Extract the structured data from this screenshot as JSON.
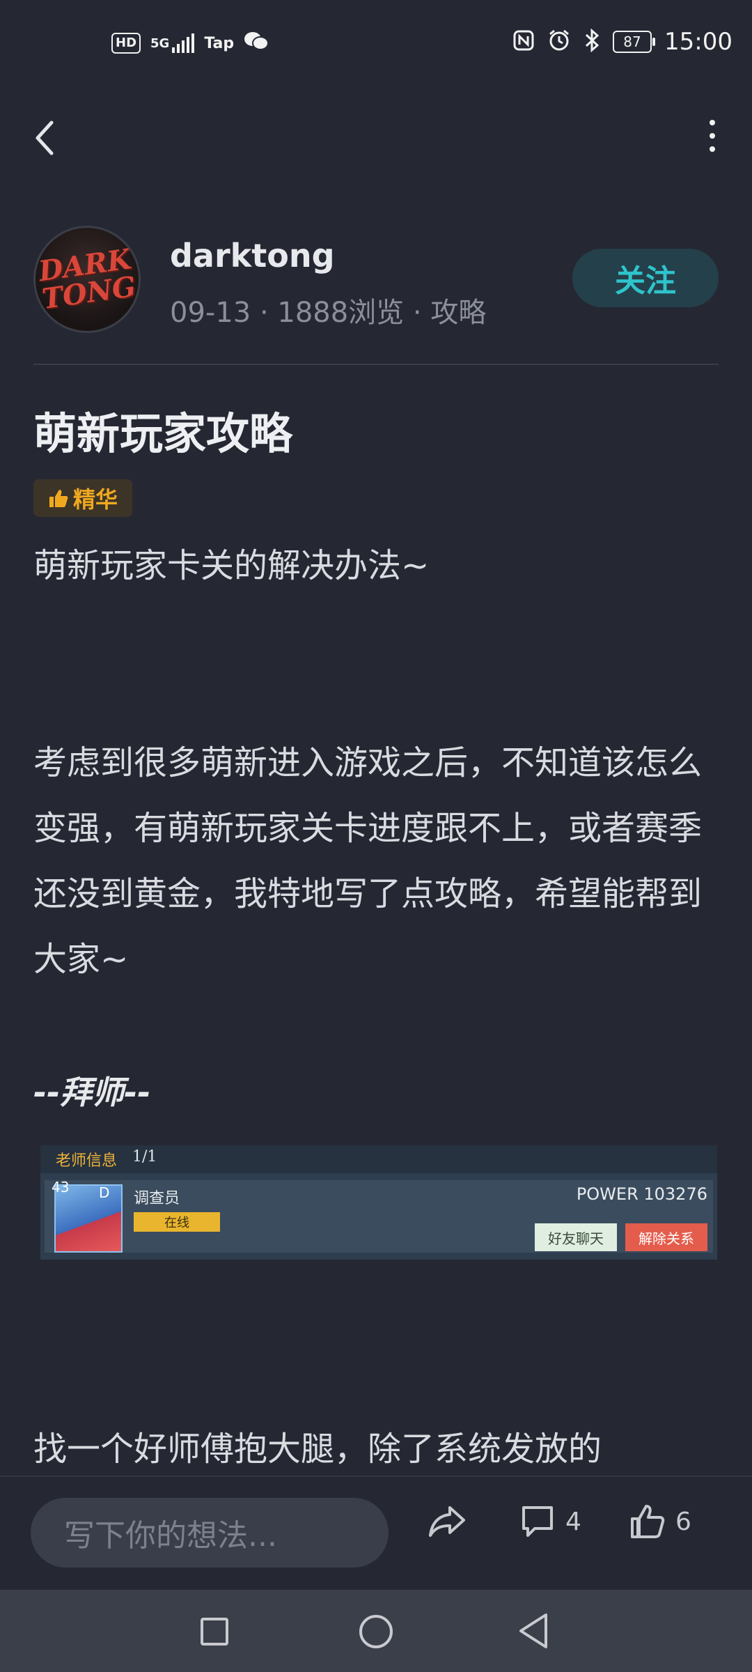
{
  "status_bar": {
    "hd": "HD",
    "network": "5G",
    "taptap": "Tap",
    "battery": "87",
    "time": "15:00"
  },
  "author": {
    "avatar_text": "DARK TONG",
    "name": "darktong",
    "meta": "09-13 · 1888浏览 · 攻略",
    "follow_label": "关注"
  },
  "article": {
    "title": "萌新玩家攻略",
    "badge": "精华",
    "paragraph1": "萌新玩家卡关的解决办法~",
    "paragraph2": "考虑到很多萌新进入游戏之后，不知道该怎么变强，有萌新玩家关卡进度跟不上，或者赛季还没到黄金，我特地写了点攻略，希望能帮到大家~",
    "section_heading": "--拜师--",
    "paragraph3": "找一个好师傅抱大腿，除了系统发放的"
  },
  "game_card": {
    "label": "老师信息",
    "count": "1/1",
    "level": "43",
    "rank": "D",
    "role": "调查员",
    "status": "在线",
    "power": "POWER 103276",
    "chat_button": "好友聊天",
    "unbind_button": "解除关系"
  },
  "bottom_bar": {
    "comment_placeholder": "写下你的想法...",
    "comment_count": "4",
    "like_count": "6"
  },
  "colors": {
    "background": "#252833",
    "accent": "#2fc4cc",
    "badge": "#f0a91f"
  }
}
